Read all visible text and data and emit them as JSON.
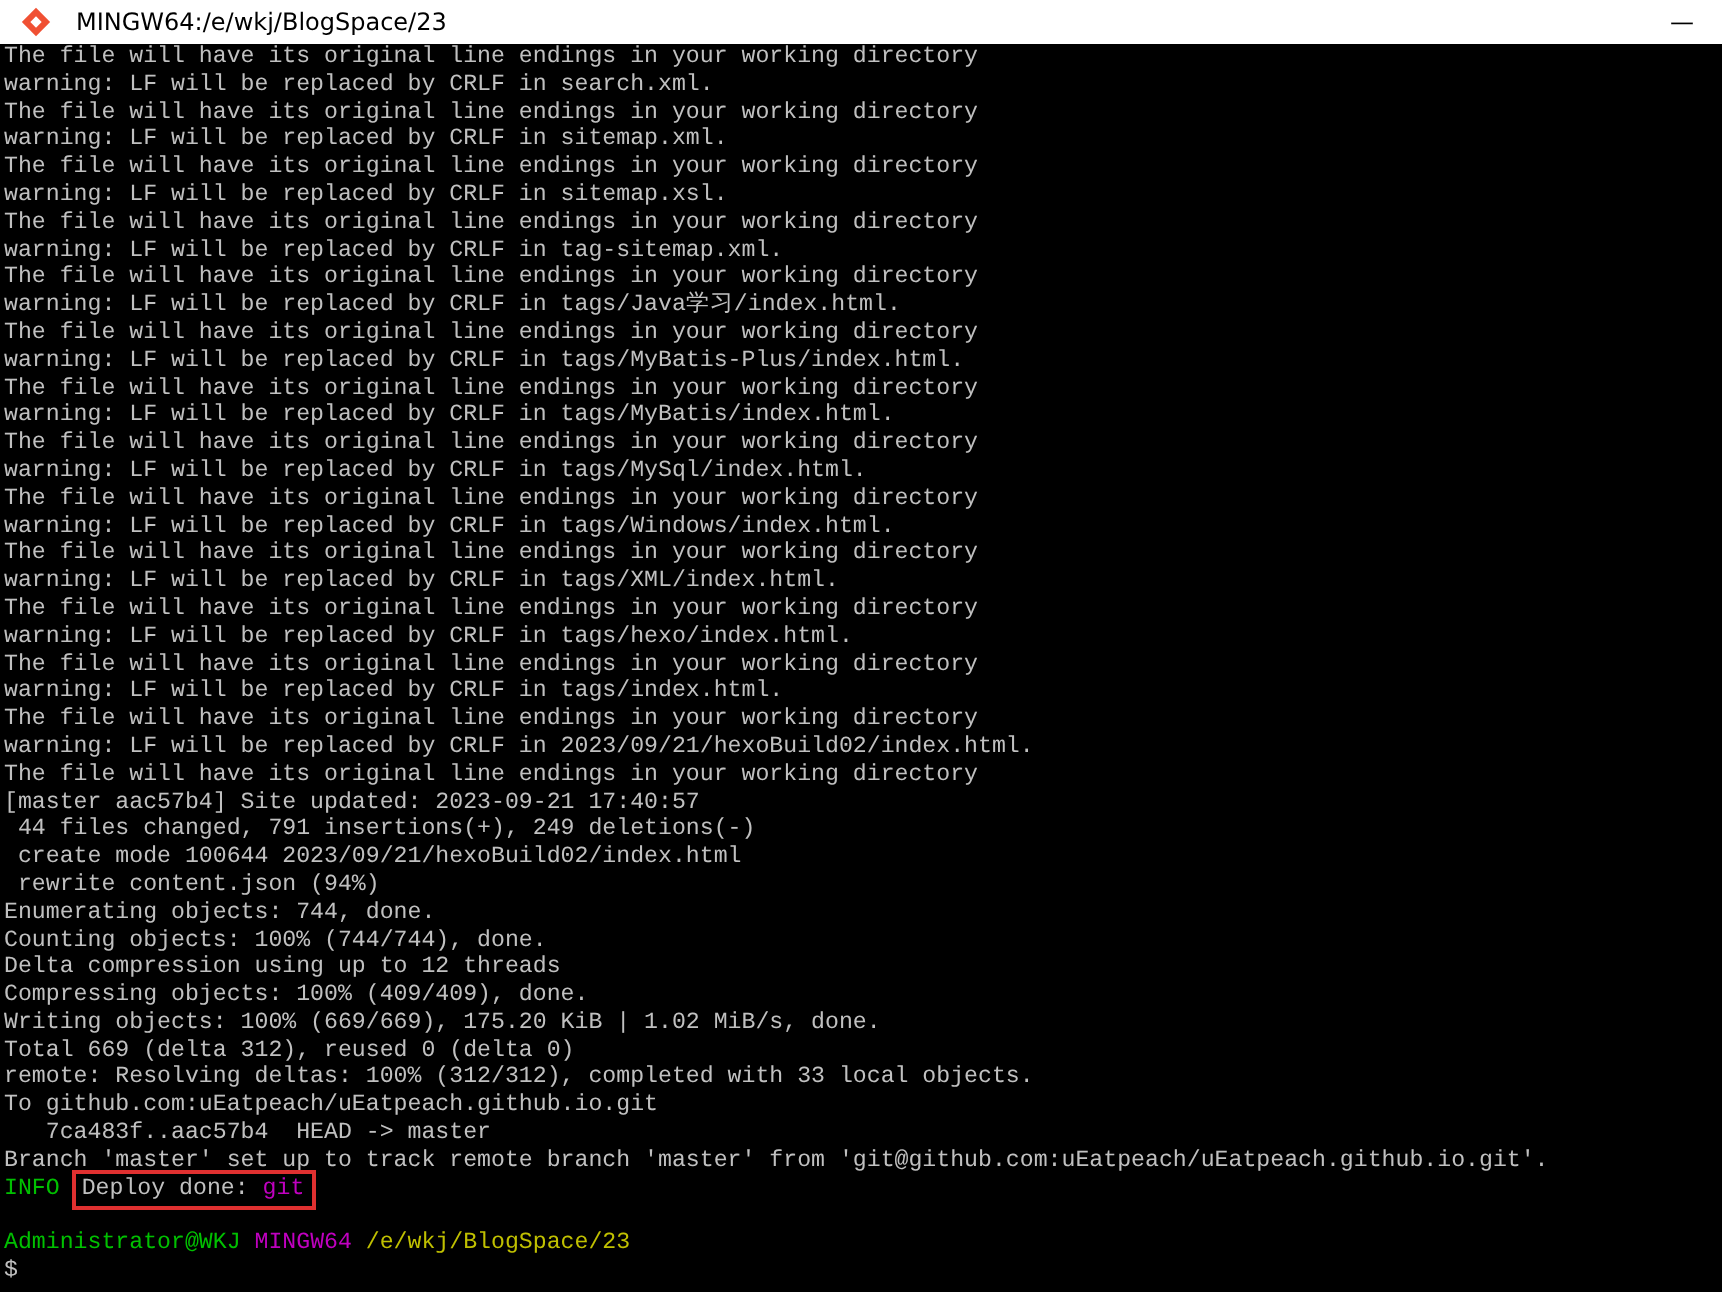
{
  "window": {
    "title": "MINGW64:/e/wkj/BlogSpace/23",
    "minimize": "—"
  },
  "lines": [
    {
      "segments": [
        {
          "text": "The file will have its original line endings in your working directory"
        }
      ]
    },
    {
      "segments": [
        {
          "text": "warning: LF will be replaced by CRLF in search.xml."
        }
      ]
    },
    {
      "segments": [
        {
          "text": "The file will have its original line endings in your working directory"
        }
      ]
    },
    {
      "segments": [
        {
          "text": "warning: LF will be replaced by CRLF in sitemap.xml."
        }
      ]
    },
    {
      "segments": [
        {
          "text": "The file will have its original line endings in your working directory"
        }
      ]
    },
    {
      "segments": [
        {
          "text": "warning: LF will be replaced by CRLF in sitemap.xsl."
        }
      ]
    },
    {
      "segments": [
        {
          "text": "The file will have its original line endings in your working directory"
        }
      ]
    },
    {
      "segments": [
        {
          "text": "warning: LF will be replaced by CRLF in tag-sitemap.xml."
        }
      ]
    },
    {
      "segments": [
        {
          "text": "The file will have its original line endings in your working directory"
        }
      ]
    },
    {
      "segments": [
        {
          "text": "warning: LF will be replaced by CRLF in tags/Java学习/index.html."
        }
      ]
    },
    {
      "segments": [
        {
          "text": "The file will have its original line endings in your working directory"
        }
      ]
    },
    {
      "segments": [
        {
          "text": "warning: LF will be replaced by CRLF in tags/MyBatis-Plus/index.html."
        }
      ]
    },
    {
      "segments": [
        {
          "text": "The file will have its original line endings in your working directory"
        }
      ]
    },
    {
      "segments": [
        {
          "text": "warning: LF will be replaced by CRLF in tags/MyBatis/index.html."
        }
      ]
    },
    {
      "segments": [
        {
          "text": "The file will have its original line endings in your working directory"
        }
      ]
    },
    {
      "segments": [
        {
          "text": "warning: LF will be replaced by CRLF in tags/MySql/index.html."
        }
      ]
    },
    {
      "segments": [
        {
          "text": "The file will have its original line endings in your working directory"
        }
      ]
    },
    {
      "segments": [
        {
          "text": "warning: LF will be replaced by CRLF in tags/Windows/index.html."
        }
      ]
    },
    {
      "segments": [
        {
          "text": "The file will have its original line endings in your working directory"
        }
      ]
    },
    {
      "segments": [
        {
          "text": "warning: LF will be replaced by CRLF in tags/XML/index.html."
        }
      ]
    },
    {
      "segments": [
        {
          "text": "The file will have its original line endings in your working directory"
        }
      ]
    },
    {
      "segments": [
        {
          "text": "warning: LF will be replaced by CRLF in tags/hexo/index.html."
        }
      ]
    },
    {
      "segments": [
        {
          "text": "The file will have its original line endings in your working directory"
        }
      ]
    },
    {
      "segments": [
        {
          "text": "warning: LF will be replaced by CRLF in tags/index.html."
        }
      ]
    },
    {
      "segments": [
        {
          "text": "The file will have its original line endings in your working directory"
        }
      ]
    },
    {
      "segments": [
        {
          "text": "warning: LF will be replaced by CRLF in 2023/09/21/hexoBuild02/index.html."
        }
      ]
    },
    {
      "segments": [
        {
          "text": "The file will have its original line endings in your working directory"
        }
      ]
    },
    {
      "segments": [
        {
          "text": "[master aac57b4] Site updated: 2023-09-21 17:40:57"
        }
      ]
    },
    {
      "segments": [
        {
          "text": " 44 files changed, 791 insertions(+), 249 deletions(-)"
        }
      ]
    },
    {
      "segments": [
        {
          "text": " create mode 100644 2023/09/21/hexoBuild02/index.html"
        }
      ]
    },
    {
      "segments": [
        {
          "text": " rewrite content.json (94%)"
        }
      ]
    },
    {
      "segments": [
        {
          "text": "Enumerating objects: 744, done."
        }
      ]
    },
    {
      "segments": [
        {
          "text": "Counting objects: 100% (744/744), done."
        }
      ]
    },
    {
      "segments": [
        {
          "text": "Delta compression using up to 12 threads"
        }
      ]
    },
    {
      "segments": [
        {
          "text": "Compressing objects: 100% (409/409), done."
        }
      ]
    },
    {
      "segments": [
        {
          "text": "Writing objects: 100% (669/669), 175.20 KiB | 1.02 MiB/s, done."
        }
      ]
    },
    {
      "segments": [
        {
          "text": "Total 669 (delta 312), reused 0 (delta 0)"
        }
      ]
    },
    {
      "segments": [
        {
          "text": "remote: Resolving deltas: 100% (312/312), completed with 33 local objects."
        }
      ]
    },
    {
      "segments": [
        {
          "text": "To github.com:uEatpeach/uEatpeach.github.io.git"
        }
      ]
    },
    {
      "segments": [
        {
          "text": "   7ca483f..aac57b4  HEAD -> master"
        }
      ]
    },
    {
      "segments": [
        {
          "text": "Branch 'master' set up to track remote branch 'master' from 'git@github.com:uEatpeach/uEatpeach.github.io.git'."
        }
      ]
    },
    {
      "segments": [
        {
          "text": "INFO",
          "color": "#00c000"
        }
      ],
      "highlight_box": [
        {
          "text": "Deploy done:"
        },
        {
          "text": "git",
          "color": "#c000c0"
        }
      ]
    },
    {
      "kind": "prompt",
      "segments": [
        {
          "text": "Administrator@WKJ",
          "color": "#00c000"
        },
        {
          "text": "MINGW64",
          "color": "#c000c0"
        },
        {
          "text": "/e/wkj/BlogSpace/23",
          "color": "#c0c000"
        }
      ]
    },
    {
      "segments": [
        {
          "text": "$"
        }
      ]
    }
  ]
}
